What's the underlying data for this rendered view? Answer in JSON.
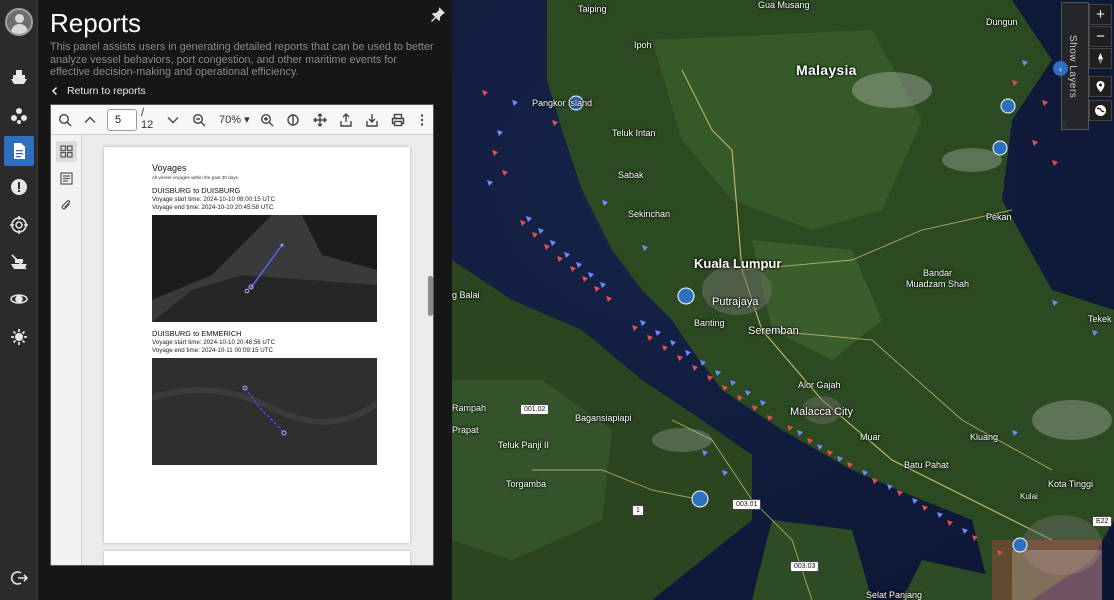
{
  "panel": {
    "title": "Reports",
    "description": "This panel assists users in generating detailed reports that can be used to better analyze vessel behaviors, port congestion, and other maritime events for effective decision-making and operational efficiency.",
    "return_label": "Return to reports"
  },
  "pdf_toolbar": {
    "page_value": "5",
    "page_total": "/ 12",
    "zoom": "70%"
  },
  "report_page": {
    "heading": "Voyages",
    "subtitle": "All vessel voyages within the past 30 days.",
    "voyages": [
      {
        "title": "DUISBURG to DUISBURG",
        "start": "Voyage start time: 2024-10-10 08:00:15 UTC",
        "end": "Voyage end time: 2024-10-10 20:45:58 UTC"
      },
      {
        "title": "DUISBURG to EMMERICH",
        "start": "Voyage start time: 2024-10-10 20:48:56 UTC",
        "end": "Voyage end time: 2024-10-11 00:09:15 UTC"
      }
    ]
  },
  "map": {
    "labels": {
      "taiping": "Taiping",
      "gua_musang": "Gua Musang",
      "dungun": "Dungun",
      "ipoh": "Ipoh",
      "malaysia": "Malaysia",
      "pangkor": "Pangkor Island",
      "teluk_intan": "Teluk Intan",
      "sabak": "Sabak",
      "sekinchan": "Sekinchan",
      "pekan": "Pekan",
      "kuala_lumpur": "Kuala Lumpur",
      "putrajaya": "Putrajaya",
      "banting": "Banting",
      "seremban": "Seremban",
      "bandar_muadzam": "Bandar\nMuadzam Shah",
      "tekek": "Tekek",
      "tg_balai": "g Balai",
      "alor_gajah": "Alor Gajah",
      "malacca": "Malacca City",
      "muar": "Muar",
      "kluang": "Kluang",
      "rampah": "Rampah",
      "bagansiapiapi": "Bagansiapiapi",
      "prapat": "Prapat",
      "teluk_panji": "Teluk Panji II",
      "batu_pahat": "Batu Pahat",
      "torgamba": "Torgamba",
      "kota_tinggi": "Kota Tinggi",
      "kulai": "Kulai",
      "selat_panjang": "Selat Panjang"
    },
    "shields": {
      "s1": "001.02",
      "s2": "003.01",
      "s3": "003.03",
      "s4": "1",
      "e22": "E22"
    }
  },
  "map_controls": {
    "zoom_in": "+",
    "zoom_out": "−",
    "show_layers": "Show Layers"
  },
  "colors": {
    "accent": "#2f6fbf",
    "vessel_red": "#e05050",
    "vessel_blue": "#6b8cff"
  }
}
